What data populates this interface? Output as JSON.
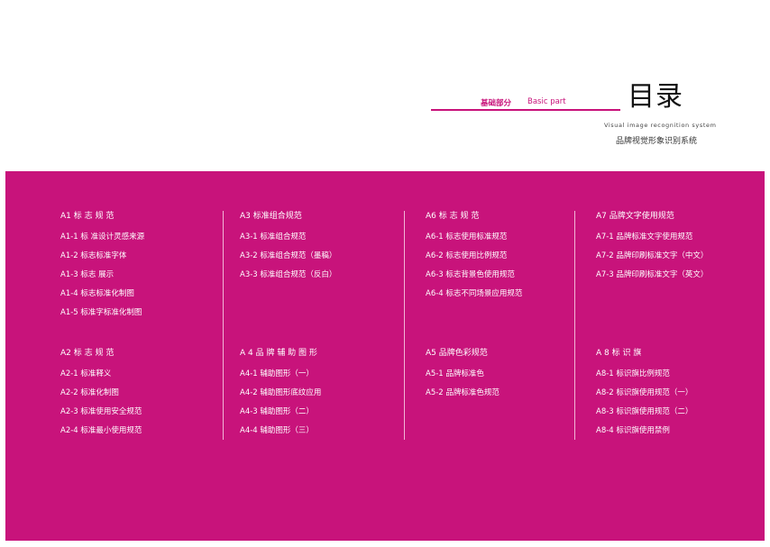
{
  "header": {
    "basic_part_cn": "基础部分",
    "basic_part_en": "Basic part",
    "title": "目录",
    "subtitle_en": "Visual image recognition system",
    "subtitle_cn": "品牌视觉形象识别系统"
  },
  "colors": {
    "brand_magenta": "#c8137b",
    "divider": "#f2b6d7",
    "text_on_brand": "#ffffff"
  },
  "sections": [
    {
      "title": "A1  标 志 规 范",
      "items": [
        "A1-1  标 准设计灵感来源",
        "A1-2  标志标准字体",
        "A1-3  标志 展示",
        "A1-4  标志标准化制图",
        "A1-5  标准字标准化制图"
      ]
    },
    {
      "title": "A3 标准组合规范",
      "items": [
        "A3-1 标准组合规范",
        "A3-2 标准组合规范（墨稿）",
        "A3-3 标准组合规范（反白）"
      ]
    },
    {
      "title": "A6  标 志 规 范",
      "items": [
        "A6-1 标志使用标准规范",
        "A6-2 标志使用比例规范",
        "A6-3 标志背景色使用规范",
        "A6-4 标志不同场景应用规范"
      ]
    },
    {
      "title": "A7 品牌文字使用规范",
      "items": [
        "A7-1 品牌标准文字使用规范",
        "A7-2 品牌印刷标准文字（中文）",
        "A7-3 品牌印刷标准文字（英文）"
      ]
    },
    {
      "title": "A2  标 志 规 范",
      "items": [
        "A2-1 标准释义",
        "A2-2 标准化制图",
        "A2-3 标准使用安全规范",
        "A2-4 标准最小使用规范"
      ]
    },
    {
      "title": "A 4  品 牌 辅 助 图 形",
      "items": [
        "A4-1 辅助图形（一）",
        "A4-2 辅助图形底纹应用",
        "A4-3 辅助图形（二）",
        "A4-4 辅助图形（三）"
      ]
    },
    {
      "title": "A5 品牌色彩规范",
      "items": [
        "A5-1 品牌标准色",
        "A5-2 品牌标准色规范"
      ]
    },
    {
      "title": "A 8  标 识 旗",
      "items": [
        "A8-1 标识旗比例规范",
        "A8-2 标识旗使用规范（一）",
        "A8-3 标识旗使用规范（二）",
        "A8-4 标识旗使用禁例"
      ]
    }
  ]
}
